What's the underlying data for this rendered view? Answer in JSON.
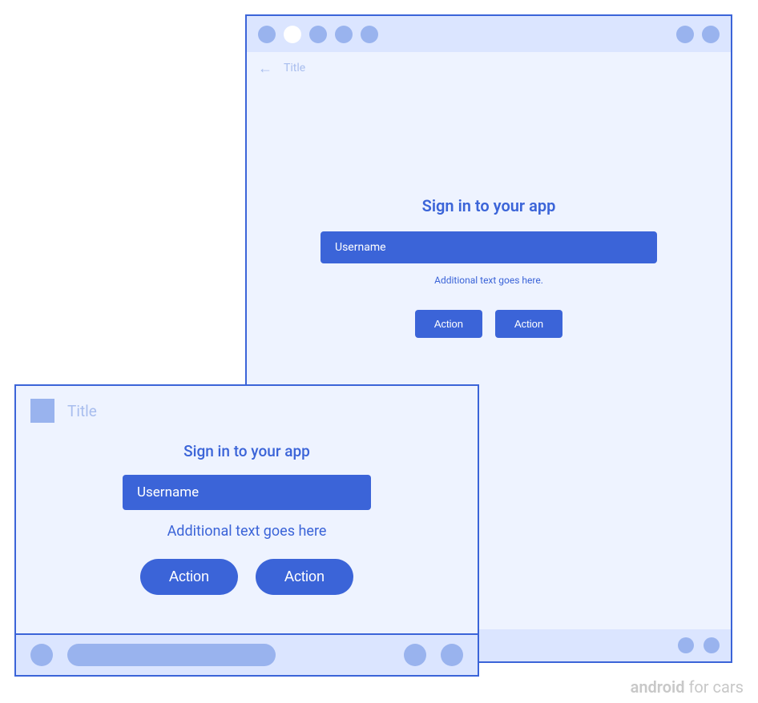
{
  "large_device": {
    "appbar": {
      "title": "Title"
    },
    "content": {
      "heading": "Sign in to your app",
      "username_label": "Username",
      "additional_text": "Additional text goes here.",
      "action1": "Action",
      "action2": "Action"
    }
  },
  "small_device": {
    "appbar": {
      "title": "Title"
    },
    "content": {
      "heading": "Sign in to your app",
      "username_label": "Username",
      "additional_text": "Additional text goes here",
      "action1": "Action",
      "action2": "Action"
    }
  },
  "brand": {
    "bold": "android",
    "light": " for cars"
  }
}
